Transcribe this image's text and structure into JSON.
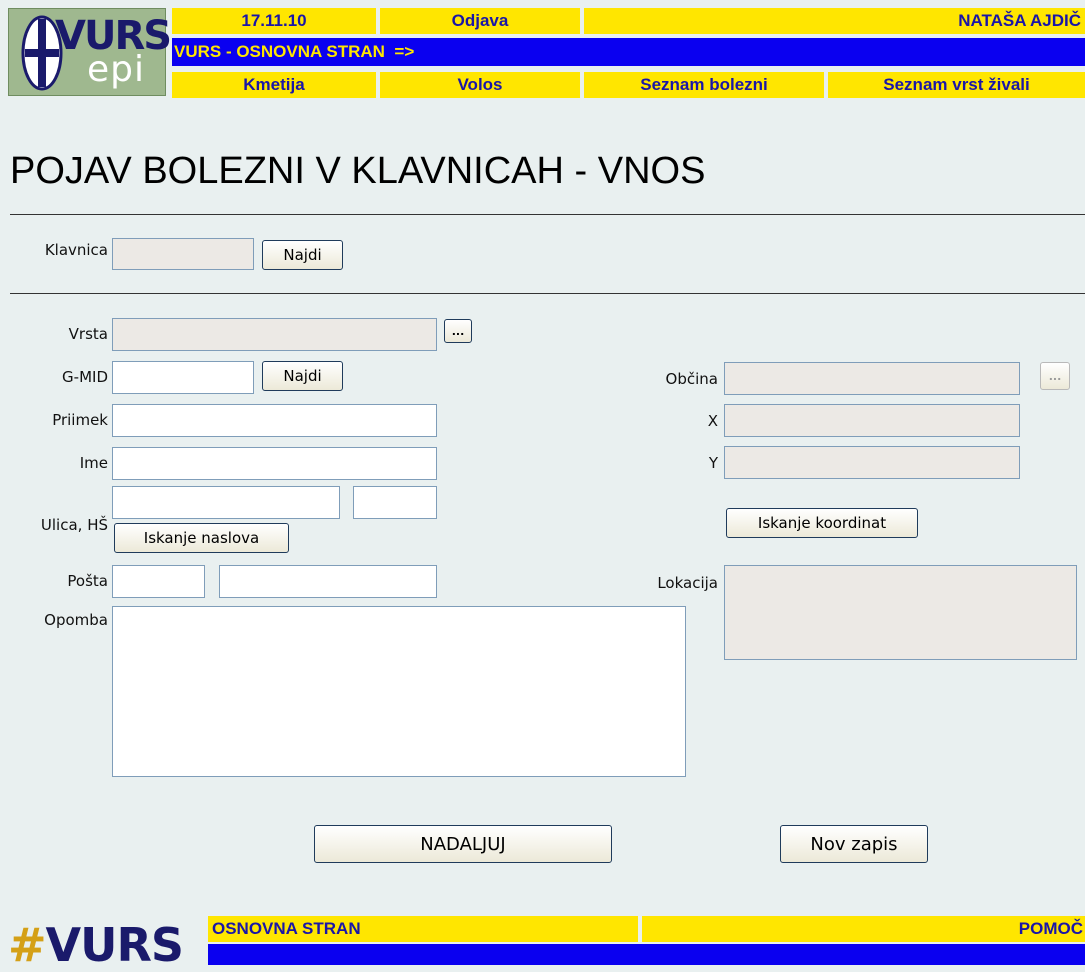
{
  "header": {
    "logo_text": "VURS",
    "logo_sub": "epi",
    "seal_letters": "SVNV",
    "date": "17.11.10",
    "logout": "Odjava",
    "user": "NATAŠA AJDIČ",
    "breadcrumb": "VURS - OSNOVNA STRAN  =>",
    "nav": [
      "Kmetija",
      "Volos",
      "Seznam bolezni",
      "Seznam vrst živali"
    ]
  },
  "page": {
    "title": "POJAV BOLEZNI V KLAVNICAH - VNOS"
  },
  "form": {
    "klavnica_label": "Klavnica",
    "klavnica_value": "",
    "najdi_label": "Najdi",
    "vrsta_label": "Vrsta",
    "vrsta_value": "",
    "ellipsis": "...",
    "gmid_label": "G-MID",
    "gmid_value": "",
    "priimek_label": "Priimek",
    "ime_label": "Ime",
    "ulica_label": "Ulica, HŠ",
    "iskanje_naslova": "Iskanje naslova",
    "posta_label": "Pošta",
    "opomba_label": "Opomba",
    "obcina_label": "Občina",
    "x_label": "X",
    "y_label": "Y",
    "iskanje_koordinat": "Iskanje koordinat",
    "lokacija_label": "Lokacija",
    "nadaljuj": "NADALJUJ",
    "nov_zapis": "Nov zapis"
  },
  "footer": {
    "logo_hash": "#",
    "logo_text": "VURS",
    "home": "OSNOVNA STRAN",
    "help": "POMOČ"
  },
  "colors": {
    "yellow": "#ffe600",
    "blue": "#0a00f0",
    "nav_text": "#1a16a8",
    "background": "#e9f0f0"
  }
}
